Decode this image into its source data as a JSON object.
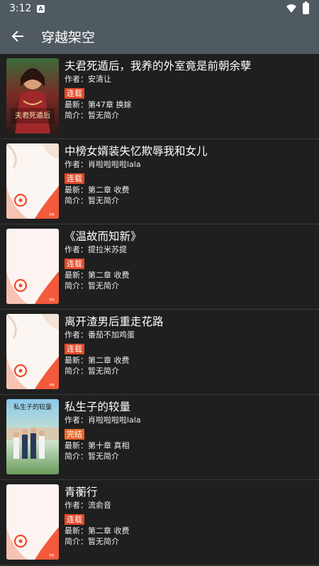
{
  "status_bar": {
    "time": "3:12",
    "notification_icon": "A"
  },
  "app_bar": {
    "title": "穿越架空",
    "back_icon": "arrow-back-icon"
  },
  "colors": {
    "app_bar": "#4f5a61",
    "background": "#1f1f1f",
    "badge_ongoing": "#e2492a",
    "badge_done": "#e8662a"
  },
  "books": [
    {
      "title": "夫君死遁后，我养的外室竟是前朝余孽",
      "author": "作者：安清让",
      "status": "连载",
      "latest": "最新：第47章 换嫁",
      "intro": "简介：暂无简介",
      "cover": "illustrated",
      "cover_text": "夫君死遁后"
    },
    {
      "title": "中榜女婿装失忆欺辱我和女儿",
      "author": "作者：肖啦啦啦啦lala",
      "status": "连载",
      "latest": "最新：第二章 收费",
      "intro": "简介：暂无简介",
      "cover": "placeholder",
      "cover_brand": "FM"
    },
    {
      "title": "《温故而知新》",
      "author": "作者：提拉米苏提",
      "status": "连载",
      "latest": "最新：第二章 收费",
      "intro": "简介：暂无简介",
      "cover": "placeholder",
      "cover_brand": "FM"
    },
    {
      "title": "离开渣男后重走花路",
      "author": "作者：番茄不加鸡蛋",
      "status": "连载",
      "latest": "最新：第二章 收费",
      "intro": "简介：暂无简介",
      "cover": "placeholder",
      "cover_brand": "FM"
    },
    {
      "title": "私生子的较量",
      "author": "作者：肖啦啦啦啦lala",
      "status": "完结",
      "latest": "最新：第十章 真相",
      "intro": "简介：暂无简介",
      "cover": "photo",
      "cover_text": "私生子的较量"
    },
    {
      "title": "青蘅行",
      "author": "作者：流俞音",
      "status": "连载",
      "latest": "最新：第二章 收费",
      "intro": "简介：暂无简介",
      "cover": "placeholder",
      "cover_brand": "FM"
    }
  ]
}
